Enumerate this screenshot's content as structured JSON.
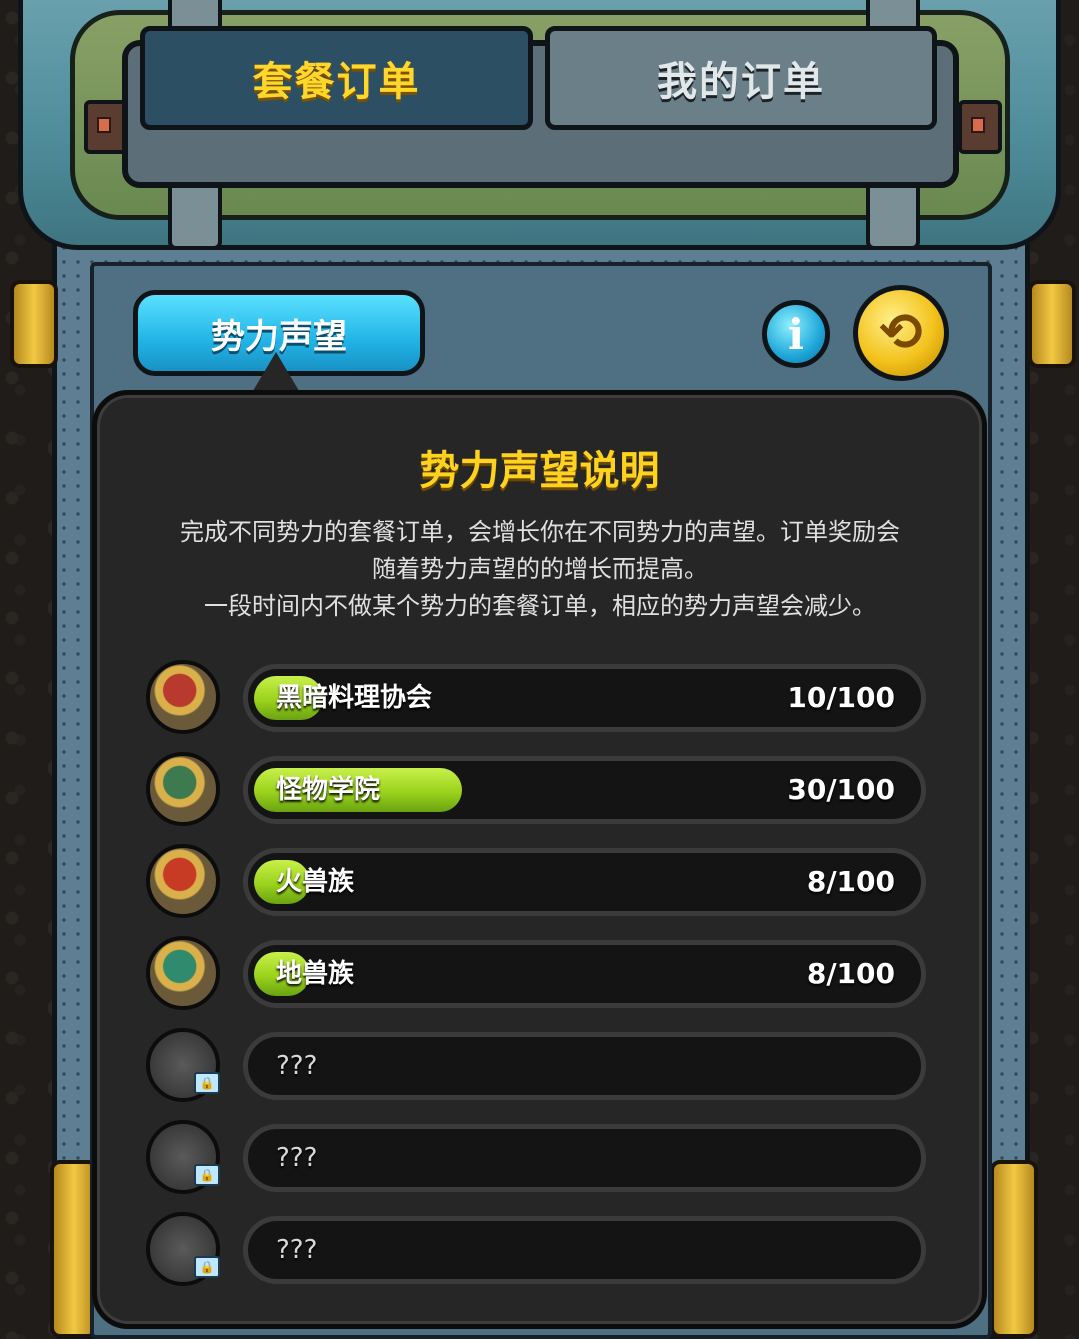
{
  "tabs": {
    "active_label": "套餐订单",
    "inactive_label": "我的订单"
  },
  "category_button": "势力声望",
  "info_icon": "i",
  "refresh_icon": "refresh-arrows-icon",
  "popup": {
    "title": "势力声望说明",
    "description_lines": [
      "完成不同势力的套餐订单，会增长你在不同势力的声望。订单奖励会",
      "随着势力声望的的增长而提高。",
      "一段时间内不做某个势力的套餐订单，相应的势力声望会减少。"
    ]
  },
  "factions": [
    {
      "name": "黑暗料理协会",
      "value_text": "10/100",
      "progress": 0.1,
      "locked": false,
      "emblem_color": "#b83a2e"
    },
    {
      "name": "怪物学院",
      "value_text": "30/100",
      "progress": 0.3,
      "locked": false,
      "emblem_color": "#3d7a4f"
    },
    {
      "name": "火兽族",
      "value_text": "8/100",
      "progress": 0.08,
      "locked": false,
      "emblem_color": "#c73a24"
    },
    {
      "name": "地兽族",
      "value_text": "8/100",
      "progress": 0.08,
      "locked": false,
      "emblem_color": "#2f8a6e"
    },
    {
      "name": "???",
      "value_text": "",
      "progress": 0,
      "locked": true,
      "emblem_color": "#4a4a4a"
    },
    {
      "name": "???",
      "value_text": "",
      "progress": 0,
      "locked": true,
      "emblem_color": "#4a4a4a"
    },
    {
      "name": "???",
      "value_text": "",
      "progress": 0,
      "locked": true,
      "emblem_color": "#4a4a4a"
    }
  ],
  "colors": {
    "title_gold": "#ffd21f",
    "progress_green": "#9ad21c",
    "tab_active_bg": "#2d4f63",
    "pill_blue": "#22b4e6"
  }
}
